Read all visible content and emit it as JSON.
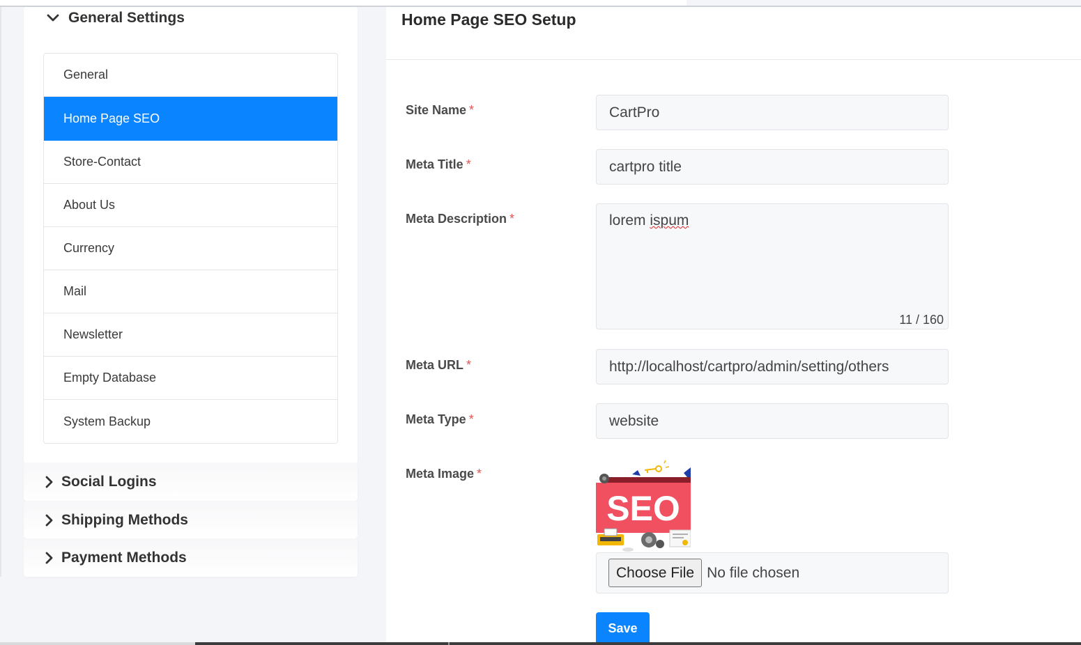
{
  "sidebar": {
    "general_settings": {
      "title": "General Settings",
      "items": [
        {
          "label": "General",
          "active": false
        },
        {
          "label": "Home Page SEO",
          "active": true
        },
        {
          "label": "Store-Contact",
          "active": false
        },
        {
          "label": "About Us",
          "active": false
        },
        {
          "label": "Currency",
          "active": false
        },
        {
          "label": "Mail",
          "active": false
        },
        {
          "label": "Newsletter",
          "active": false
        },
        {
          "label": "Empty Database",
          "active": false
        },
        {
          "label": "System Backup",
          "active": false
        }
      ]
    },
    "social_logins": {
      "title": "Social Logins"
    },
    "shipping_methods": {
      "title": "Shipping Methods"
    },
    "payment_methods": {
      "title": "Payment Methods"
    }
  },
  "main": {
    "title": "Home Page SEO Setup",
    "required_mark": "*",
    "fields": {
      "site_name": {
        "label": "Site Name",
        "value": "CartPro"
      },
      "meta_title": {
        "label": "Meta Title",
        "value": "cartpro title"
      },
      "meta_description": {
        "label": "Meta Description",
        "value_word1": "lorem",
        "value_word2": "ispum",
        "counter": "11 / 160"
      },
      "meta_url": {
        "label": "Meta URL",
        "value": "http://localhost/cartpro/admin/setting/others"
      },
      "meta_type": {
        "label": "Meta Type",
        "value": "website"
      },
      "meta_image": {
        "label": "Meta Image",
        "image_text": "SEO",
        "choose_file": "Choose File",
        "no_file": "No file chosen"
      }
    },
    "save_label": "Save"
  },
  "colors": {
    "accent": "#0b84ff",
    "required": "#e55353",
    "seo_banner": "#f0505f"
  },
  "icons": {
    "expanded": "chevron-down-icon",
    "collapsed": "chevron-right-icon"
  }
}
